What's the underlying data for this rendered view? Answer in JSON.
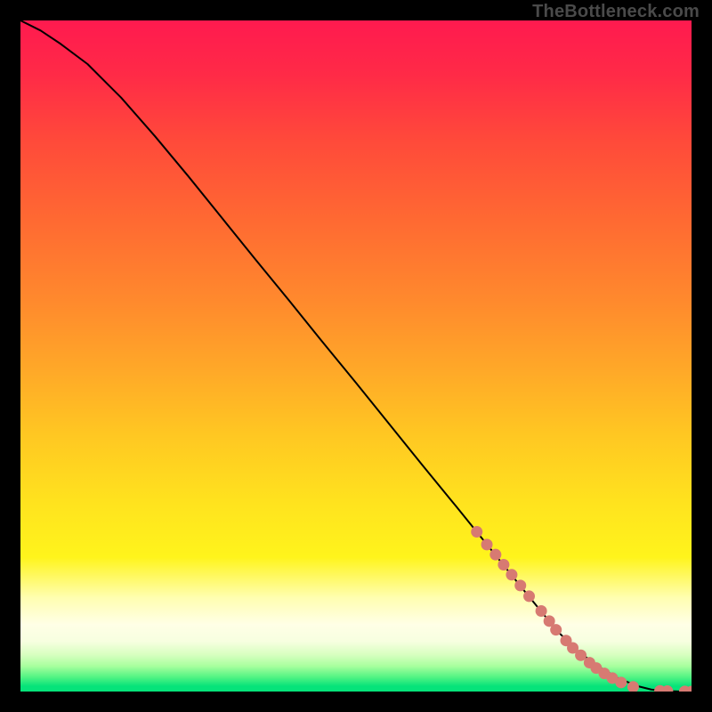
{
  "watermark": "TheBottleneck.com",
  "colors": {
    "dot": "#d77a72",
    "curve": "#000000"
  },
  "gradient_stops": [
    {
      "offset": 0.0,
      "color": "#ff1a4f"
    },
    {
      "offset": 0.08,
      "color": "#ff2a47"
    },
    {
      "offset": 0.18,
      "color": "#ff4a3a"
    },
    {
      "offset": 0.3,
      "color": "#ff6a32"
    },
    {
      "offset": 0.42,
      "color": "#ff8a2d"
    },
    {
      "offset": 0.52,
      "color": "#ffa828"
    },
    {
      "offset": 0.62,
      "color": "#ffc822"
    },
    {
      "offset": 0.72,
      "color": "#ffe31e"
    },
    {
      "offset": 0.8,
      "color": "#fff41c"
    },
    {
      "offset": 0.86,
      "color": "#fffeb0"
    },
    {
      "offset": 0.9,
      "color": "#ffffe6"
    },
    {
      "offset": 0.925,
      "color": "#f7ffe0"
    },
    {
      "offset": 0.945,
      "color": "#d8ffc0"
    },
    {
      "offset": 0.962,
      "color": "#a8ff9e"
    },
    {
      "offset": 0.978,
      "color": "#55f484"
    },
    {
      "offset": 0.992,
      "color": "#06e37a"
    },
    {
      "offset": 1.0,
      "color": "#06e37a"
    }
  ],
  "chart_data": {
    "type": "line",
    "title": "",
    "xlabel": "",
    "ylabel": "",
    "xlim": [
      0,
      100
    ],
    "ylim": [
      0,
      100
    ],
    "series": [
      {
        "name": "curve",
        "x": [
          0,
          3,
          6,
          10,
          15,
          20,
          25,
          30,
          35,
          40,
          45,
          50,
          55,
          60,
          65,
          70,
          75,
          80,
          83,
          86,
          89,
          92,
          94,
          96,
          98,
          100
        ],
        "y": [
          100,
          98.5,
          96.5,
          93.5,
          88.5,
          82.8,
          76.8,
          70.6,
          64.4,
          58.3,
          52.1,
          46.0,
          39.8,
          33.6,
          27.5,
          21.3,
          15.1,
          9.0,
          6.1,
          3.8,
          2.0,
          0.8,
          0.3,
          0.08,
          0.02,
          0.0
        ]
      }
    ],
    "dots": {
      "name": "highlighted-points",
      "points": [
        {
          "x": 68.0,
          "y": 23.8
        },
        {
          "x": 69.5,
          "y": 21.9
        },
        {
          "x": 70.8,
          "y": 20.4
        },
        {
          "x": 72.0,
          "y": 18.9
        },
        {
          "x": 73.2,
          "y": 17.4
        },
        {
          "x": 74.5,
          "y": 15.8
        },
        {
          "x": 75.8,
          "y": 14.2
        },
        {
          "x": 77.6,
          "y": 12.0
        },
        {
          "x": 78.8,
          "y": 10.5
        },
        {
          "x": 79.8,
          "y": 9.2
        },
        {
          "x": 81.3,
          "y": 7.6
        },
        {
          "x": 82.3,
          "y": 6.5
        },
        {
          "x": 83.5,
          "y": 5.4
        },
        {
          "x": 84.8,
          "y": 4.3
        },
        {
          "x": 85.8,
          "y": 3.5
        },
        {
          "x": 87.0,
          "y": 2.7
        },
        {
          "x": 88.2,
          "y": 2.0
        },
        {
          "x": 89.5,
          "y": 1.35
        },
        {
          "x": 91.3,
          "y": 0.7
        },
        {
          "x": 95.3,
          "y": 0.1
        },
        {
          "x": 96.4,
          "y": 0.06
        },
        {
          "x": 99.0,
          "y": 0.02
        },
        {
          "x": 100.0,
          "y": 0.0
        }
      ]
    }
  }
}
